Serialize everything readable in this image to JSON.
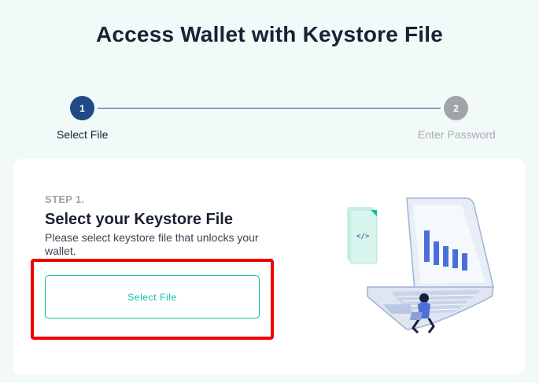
{
  "page": {
    "title": "Access Wallet with Keystore File"
  },
  "stepper": {
    "steps": [
      {
        "number": "1",
        "label": "Select File",
        "state": "active"
      },
      {
        "number": "2",
        "label": "Enter Password",
        "state": "inactive"
      }
    ]
  },
  "card": {
    "step_label": "STEP 1.",
    "heading": "Select your Keystore File",
    "description": "Please select keystore file that unlocks your wallet.",
    "select_button": "Select File"
  },
  "colors": {
    "background": "#f2f9f9",
    "primary_dark": "#1f4a85",
    "accent_teal": "#05c0a5",
    "inactive_gray": "#a1a5a8",
    "highlight_red": "#ee0000"
  },
  "icons": {
    "illustration": "laptop-with-chart-and-person-illustration",
    "code_file": "code-file-icon"
  }
}
